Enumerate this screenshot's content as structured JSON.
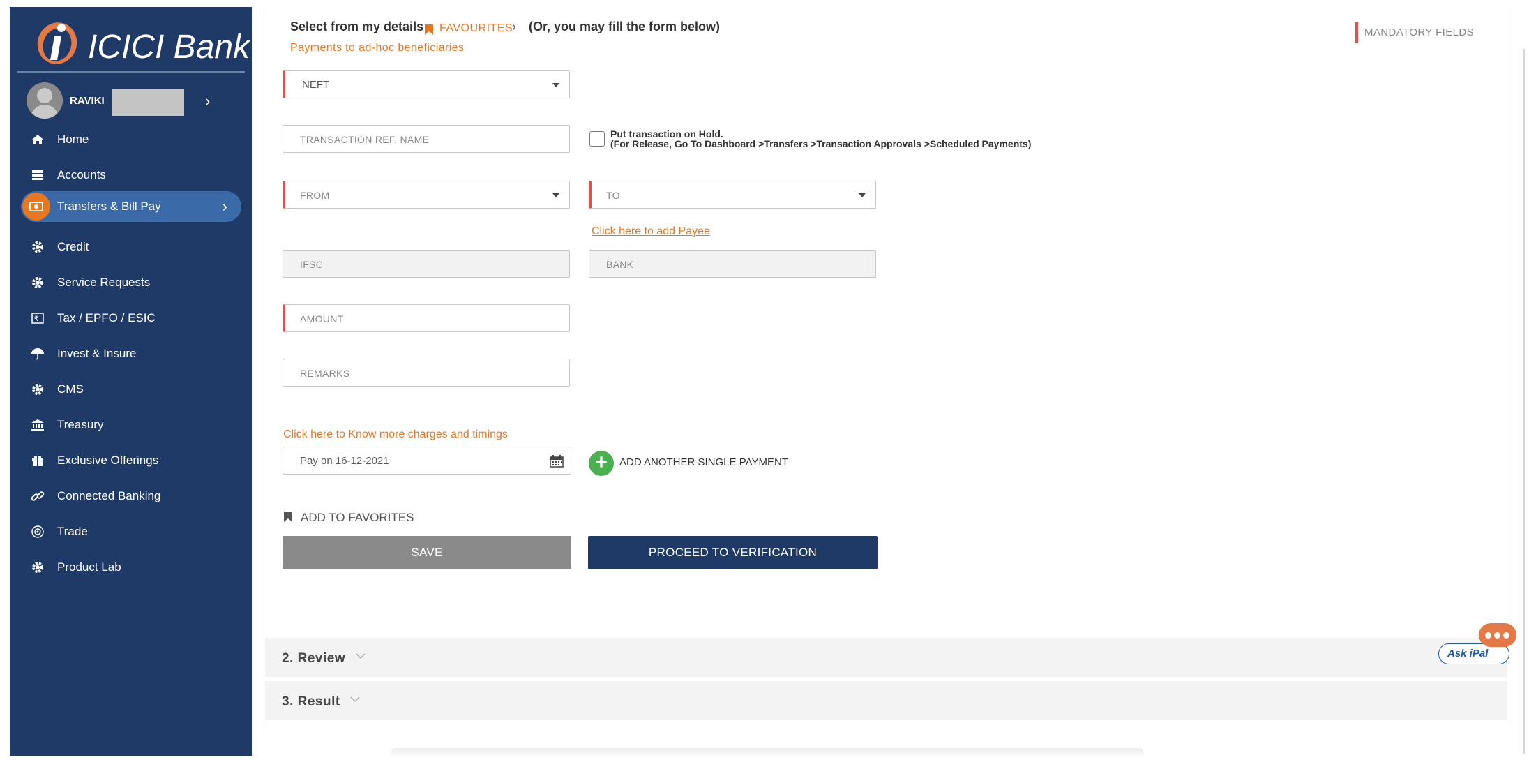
{
  "user": {
    "name": "RAVIKI"
  },
  "sidebar": {
    "items": [
      {
        "label": "Home",
        "icon": "home-icon"
      },
      {
        "label": "Accounts",
        "icon": "accounts-icon"
      },
      {
        "label": "Transfers & Bill Pay",
        "icon": "transfer-icon",
        "active": true
      },
      {
        "label": "Credit",
        "icon": "gear-icon"
      },
      {
        "label": "Service Requests",
        "icon": "gear-icon"
      },
      {
        "label": "Tax / EPFO / ESIC",
        "icon": "tax-icon"
      },
      {
        "label": "Invest & Insure",
        "icon": "umbrella-icon"
      },
      {
        "label": "CMS",
        "icon": "gear-icon"
      },
      {
        "label": "Treasury",
        "icon": "bank-building-icon"
      },
      {
        "label": "Exclusive Offerings",
        "icon": "gift-icon"
      },
      {
        "label": "Connected Banking",
        "icon": "link-icon"
      },
      {
        "label": "Trade",
        "icon": "globe-icon"
      },
      {
        "label": "Product Lab",
        "icon": "gear-icon"
      }
    ]
  },
  "brand": {
    "logo_text": "ICICI Bank",
    "primary_color": "#1f3a66",
    "accent_color": "#e87722",
    "mandatory_color": "#d9534f"
  },
  "header": {
    "select_text": "Select from my details",
    "favourites": "FAVOURITES",
    "or_text": "(Or, you may fill the form below)",
    "adhoc": "Payments to ad-hoc beneficiaries",
    "mandatory": "MANDATORY FIELDS"
  },
  "form": {
    "payment_mode": "NEFT",
    "txn_ref_placeholder": "TRANSACTION REF. NAME",
    "hold_line1": "Put transaction on Hold.",
    "hold_line2": "(For Release, Go To Dashboard >Transfers >Transaction Approvals >Scheduled Payments)",
    "hold_checked": false,
    "from_placeholder": "FROM",
    "to_placeholder": "TO",
    "add_payee": "Click here to add Payee",
    "ifsc_placeholder": "IFSC",
    "bank_placeholder": "BANK",
    "amount_placeholder": "AMOUNT",
    "remarks_placeholder": "REMARKS",
    "charges_link": "Click here to Know more charges and timings",
    "pay_on": "Pay on 16-12-2021",
    "add_another": "ADD ANOTHER SINGLE PAYMENT",
    "add_to_favorites": "ADD TO FAVORITES",
    "save": "SAVE",
    "proceed": "PROCEED TO VERIFICATION"
  },
  "steps": {
    "review": "2. Review",
    "result": "3. Result"
  },
  "askipal": {
    "label": "Ask iPal"
  }
}
